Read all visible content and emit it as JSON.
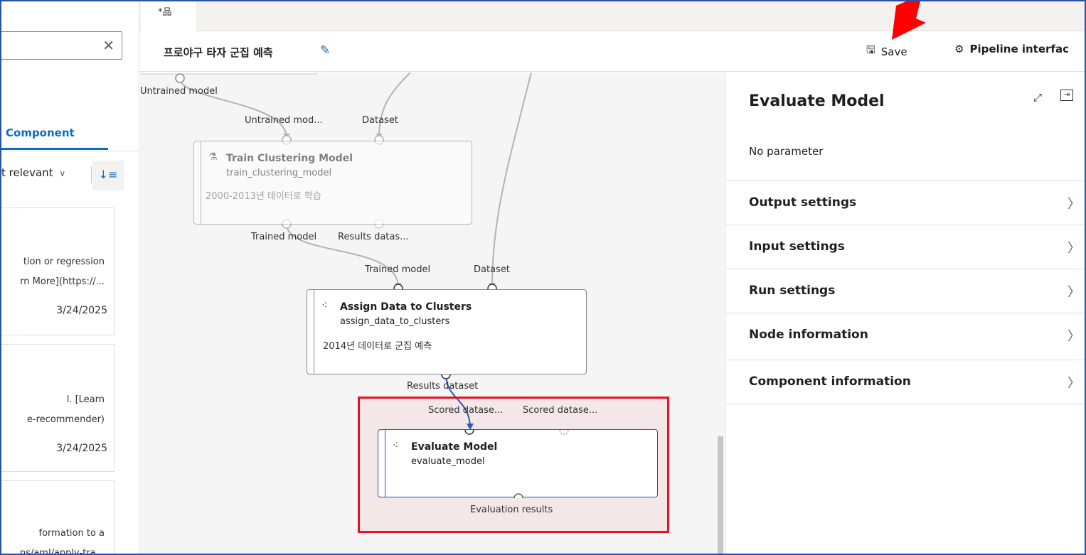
{
  "search": {
    "clear_icon": "close-icon",
    "clear_glyph": "✕"
  },
  "left_panel": {
    "active_tab": "Component",
    "sort_label": "t relevant",
    "sort_chevron": "∨",
    "sort_icon": "sort-icon",
    "sort_glyph": "↓≡",
    "cards": [
      {
        "line1": "tion or regression",
        "line2": "rn More](https://...",
        "date": "3/24/2025"
      },
      {
        "line1": "l. [Learn",
        "line2": "e-recommender)",
        "date": "3/24/2025"
      },
      {
        "line1": "formation to a",
        "line2": "ns/aml/apply-tra..."
      }
    ]
  },
  "tab_strip": {
    "active_tab_icon": "pipeline-draft-icon",
    "active_tab_glyph": "*品"
  },
  "title_bar": {
    "title": "프로야구 타자 군집 예측",
    "edit_icon": "pencil-icon",
    "edit_glyph": "✎",
    "save_label": "Save",
    "save_icon": "save-icon",
    "save_glyph": "🖫",
    "pipeline_interface_label": "Pipeline interfac",
    "pipeline_interface_icon": "gear-icon",
    "pipeline_interface_glyph": "⚙"
  },
  "canvas": {
    "top_output_label": "Untrained model",
    "train_node": {
      "input_labels": [
        "Untrained mod...",
        "Dataset"
      ],
      "title": "Train Clustering Model",
      "name": "train_clustering_model",
      "description": "2000-2013년 데이터로 학습",
      "output_labels": [
        "Trained model",
        "Results datas..."
      ],
      "icon_glyph": "⚗"
    },
    "assign_node": {
      "input_labels": [
        "Trained model",
        "Dataset"
      ],
      "title": "Assign Data to Clusters",
      "name": "assign_data_to_clusters",
      "description": "2014년 데이터로 군집 예측",
      "output_labels": [
        "Results dataset"
      ],
      "icon_glyph": "⁖"
    },
    "evaluate_node": {
      "input_labels": [
        "Scored datase...",
        "Scored datase..."
      ],
      "title": "Evaluate Model",
      "name": "evaluate_model",
      "output_labels": [
        "Evaluation results"
      ],
      "icon_glyph": "⁖"
    }
  },
  "right_panel": {
    "title": "Evaluate Model",
    "expand_icon": "expand-icon",
    "expand_glyph": "⤢",
    "collapse_icon": "collapse-panel-icon",
    "collapse_glyph": "⇥",
    "no_parameter": "No parameter",
    "sections": [
      "Output settings",
      "Input settings",
      "Run settings",
      "Node information",
      "Component information"
    ],
    "chevron": "〉"
  },
  "colors": {
    "accent": "#0f6cbd",
    "highlight": "#e81123",
    "connector": "#1f5bc4"
  }
}
